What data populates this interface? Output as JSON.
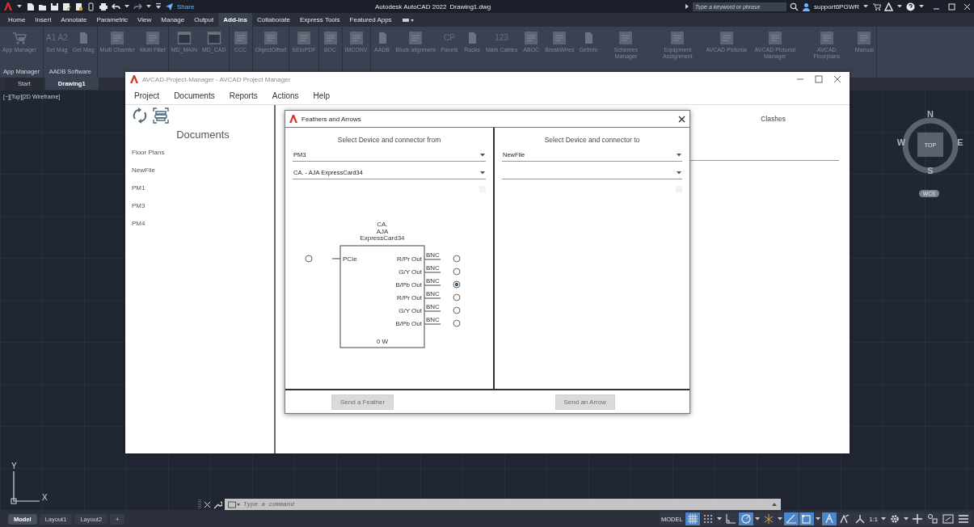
{
  "title_bar": {
    "share": "Share",
    "title": "Autodesk AutoCAD 2022",
    "file": "Drawing1.dwg",
    "search": {
      "placeholder": "Type a keyword or phrase"
    },
    "user": "support6PGWR"
  },
  "ribbon_tabs": [
    {
      "label": "Home",
      "selected": false
    },
    {
      "label": "Insert",
      "selected": false
    },
    {
      "label": "Annotate",
      "selected": false
    },
    {
      "label": "Parametric",
      "selected": false
    },
    {
      "label": "View",
      "selected": false
    },
    {
      "label": "Manage",
      "selected": false
    },
    {
      "label": "Output",
      "selected": false
    },
    {
      "label": "Add-ins",
      "selected": true
    },
    {
      "label": "Collaborate",
      "selected": false
    },
    {
      "label": "Express Tools",
      "selected": false
    },
    {
      "label": "Featured Apps",
      "selected": false
    }
  ],
  "ribbon_panels": [
    {
      "label": "App Manager",
      "buttons": [
        {
          "label": "App Manager",
          "kind": "cart"
        }
      ]
    },
    {
      "label": "AADB Software",
      "buttons": [
        {
          "label": "Set Mag",
          "kind": "text",
          "icon_text": "A1 A2"
        },
        {
          "label": "Get Mag",
          "kind": "page"
        }
      ]
    },
    {
      "buttons": [
        {
          "label": "Multi Chamfer",
          "kind": "tile"
        },
        {
          "label": "Multi Fillet",
          "kind": "tile"
        }
      ]
    },
    {
      "buttons": [
        {
          "label": "MD_MAIN",
          "kind": "window"
        },
        {
          "label": "MD_CAD",
          "kind": "window"
        }
      ]
    },
    {
      "buttons": [
        {
          "label": "CCC",
          "kind": "tile"
        }
      ]
    },
    {
      "buttons": [
        {
          "label": "ObjectOffset",
          "kind": "tile"
        }
      ]
    },
    {
      "buttons": [
        {
          "label": "SEtoPDF",
          "kind": "tile"
        }
      ]
    },
    {
      "buttons": [
        {
          "label": "BOC",
          "kind": "tile"
        }
      ]
    },
    {
      "buttons": [
        {
          "label": "IMCONV",
          "kind": "tile"
        }
      ]
    },
    {
      "buttons": [
        {
          "label": "AADB",
          "kind": "page"
        },
        {
          "label": "Block alignment",
          "kind": "tile"
        },
        {
          "label": "Panels",
          "kind": "text",
          "icon_text": "CP"
        },
        {
          "label": "Racks",
          "kind": "page"
        },
        {
          "label": "Mark Cables",
          "kind": "text",
          "icon_text": "123"
        },
        {
          "label": "ABOC",
          "kind": "tile"
        },
        {
          "label": "BreakWires",
          "kind": "tile"
        },
        {
          "label": "GetInfo",
          "kind": "page"
        },
        {
          "label": "Schemes Manager",
          "kind": "tile"
        },
        {
          "label": "Equipment Assignment",
          "kind": "tile"
        },
        {
          "label": "AVCAD Pictorial",
          "kind": "tile"
        },
        {
          "label": "AVCAD Pictorial Manager",
          "kind": "tile"
        },
        {
          "label": "AVCAD Floorplans",
          "kind": "tile"
        },
        {
          "label": "Manual",
          "kind": "tile"
        }
      ]
    }
  ],
  "document_tabs": [
    {
      "label": "Start",
      "selected": false
    },
    {
      "label": "Drawing1",
      "selected": true
    }
  ],
  "viewport_label": "[−][Top][2D Wireframe]",
  "compass": {
    "north": "N",
    "south": "S",
    "east": "E",
    "west": "W",
    "top": "TOP",
    "ucs": "WCS"
  },
  "ucs_icon": {
    "x": "X",
    "y": "Y"
  },
  "command_line": {
    "placeholder": "Type a command"
  },
  "layout_tabs": [
    {
      "label": "Model",
      "selected": true
    },
    {
      "label": "Layout1",
      "selected": false
    },
    {
      "label": "Layout2",
      "selected": false
    }
  ],
  "add_layout": "+",
  "status_items": [
    {
      "kind": "label",
      "label": "MODEL"
    },
    {
      "kind": "grid",
      "on": true
    },
    {
      "kind": "snap",
      "on": false
    },
    {
      "kind": "dropdown"
    },
    {
      "kind": "ortho",
      "on": false
    },
    {
      "kind": "polar",
      "on": true
    },
    {
      "kind": "dropdown"
    },
    {
      "kind": "isodraft",
      "on": false
    },
    {
      "kind": "dropdown"
    },
    {
      "kind": "angle",
      "on": true
    },
    {
      "kind": "selection",
      "on": true
    },
    {
      "kind": "dropdown"
    },
    {
      "kind": "annotation",
      "on": true
    },
    {
      "kind": "autoscale",
      "on": false
    },
    {
      "kind": "annoscale",
      "on": false
    },
    {
      "kind": "label",
      "label": "1:1"
    },
    {
      "kind": "dropdown"
    },
    {
      "kind": "gear"
    },
    {
      "kind": "dropdown"
    },
    {
      "kind": "plus"
    },
    {
      "kind": "isolate"
    },
    {
      "kind": "fullscreen"
    },
    {
      "kind": "menu"
    }
  ],
  "project_manager": {
    "title": "AVCAD-Project-Manager - AVCAD Project Manager",
    "menu": [
      "Project",
      "Documents",
      "Reports",
      "Actions",
      "Help"
    ],
    "sidebar": {
      "heading": "Documents",
      "items": [
        {
          "label": "Floor Plans",
          "selected": false
        },
        {
          "label": "NewFile",
          "selected": false
        },
        {
          "label": "PM1",
          "selected": false
        },
        {
          "label": "PM3",
          "selected": false
        },
        {
          "label": "PM4",
          "selected": false
        }
      ]
    },
    "header_label": "Clashes"
  },
  "dialog": {
    "title": "Feathers and Arrows",
    "from": {
      "heading": "Select Device and connector from",
      "device": "PM3",
      "connector": "CA. - AJA ExpressCard34"
    },
    "to": {
      "heading": "Select Device and connector to",
      "device": "NewFile"
    },
    "diagram": {
      "device_label": [
        "CA.",
        "AJA",
        "ExpressCard34"
      ],
      "input": {
        "label": "PCIe",
        "selected": false
      },
      "outputs": [
        {
          "label": "R/Pr Out",
          "connector": "BNC",
          "selected": false
        },
        {
          "label": "G/Y Out",
          "connector": "BNC",
          "selected": false
        },
        {
          "label": "B/Pb Out",
          "connector": "BNC",
          "selected": true
        },
        {
          "label": "R/Pr Out",
          "connector": "BNC",
          "selected": false
        },
        {
          "label": "G/Y Out",
          "connector": "BNC",
          "selected": false
        },
        {
          "label": "B/Pb Out",
          "connector": "BNC",
          "selected": false
        }
      ],
      "power": "0 W"
    },
    "buttons": [
      {
        "label": "Send a Feather",
        "disabled": true
      },
      {
        "label": "Send an Arrow",
        "disabled": true
      }
    ]
  }
}
